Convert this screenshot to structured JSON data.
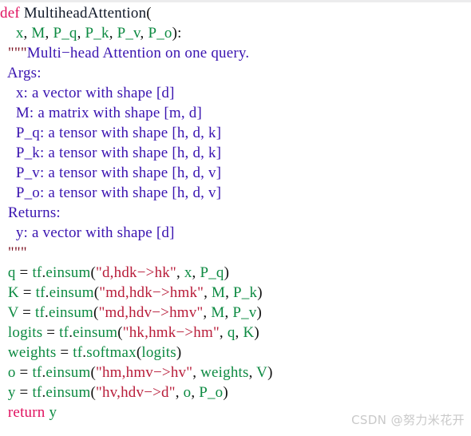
{
  "watermark": {
    "text": "CSDN @努力米花开"
  },
  "colors": {
    "background": "#ffffff",
    "keyword": "#e0115f",
    "function_name": "#101828",
    "punctuation": "#101010",
    "identifier": "#0d8a42",
    "string": "#b81d3a",
    "triple_quote": "#7a1020",
    "docstring": "#3a14b0",
    "watermark": "#c9c9c9",
    "top_strip": "#ececed"
  },
  "code": {
    "language": "python",
    "lines": [
      {
        "id": "line-01-def",
        "tokens": [
          {
            "t": "def",
            "c": "kw"
          },
          {
            "t": " ",
            "c": "punct"
          },
          {
            "t": "MultiheadAttention",
            "c": "fn"
          },
          {
            "t": "(",
            "c": "punct"
          }
        ]
      },
      {
        "id": "line-02-params",
        "tokens": [
          {
            "t": "    ",
            "c": "punct"
          },
          {
            "t": "x",
            "c": "name"
          },
          {
            "t": ", ",
            "c": "punct"
          },
          {
            "t": "M",
            "c": "name"
          },
          {
            "t": ", ",
            "c": "punct"
          },
          {
            "t": "P_q",
            "c": "name"
          },
          {
            "t": ", ",
            "c": "punct"
          },
          {
            "t": "P_k",
            "c": "name"
          },
          {
            "t": ", ",
            "c": "punct"
          },
          {
            "t": "P_v",
            "c": "name"
          },
          {
            "t": ", ",
            "c": "punct"
          },
          {
            "t": "P_o",
            "c": "name"
          },
          {
            "t": "):",
            "c": "punct"
          }
        ]
      },
      {
        "id": "line-03-docstring-open",
        "tokens": [
          {
            "t": "  ",
            "c": "punct"
          },
          {
            "t": "\"\"\"",
            "c": "quote"
          },
          {
            "t": "Multi−head Attention on one query.",
            "c": "doc"
          }
        ]
      },
      {
        "id": "line-04-args",
        "tokens": [
          {
            "t": "  ",
            "c": "punct"
          },
          {
            "t": "Args:",
            "c": "doc"
          }
        ]
      },
      {
        "id": "line-05-arg-x",
        "tokens": [
          {
            "t": "    ",
            "c": "punct"
          },
          {
            "t": "x: a vector with shape [d]",
            "c": "doc"
          }
        ]
      },
      {
        "id": "line-06-arg-M",
        "tokens": [
          {
            "t": "    ",
            "c": "punct"
          },
          {
            "t": "M: a matrix with shape [m, d]",
            "c": "doc"
          }
        ]
      },
      {
        "id": "line-07-arg-Pq",
        "tokens": [
          {
            "t": "    ",
            "c": "punct"
          },
          {
            "t": "P_q: a tensor with shape [h, d, k]",
            "c": "doc"
          }
        ]
      },
      {
        "id": "line-08-arg-Pk",
        "tokens": [
          {
            "t": "    ",
            "c": "punct"
          },
          {
            "t": "P_k: a tensor with shape [h, d, k]",
            "c": "doc"
          }
        ]
      },
      {
        "id": "line-09-arg-Pv",
        "tokens": [
          {
            "t": "    ",
            "c": "punct"
          },
          {
            "t": "P_v: a tensor with shape [h, d, v]",
            "c": "doc"
          }
        ]
      },
      {
        "id": "line-10-arg-Po",
        "tokens": [
          {
            "t": "    ",
            "c": "punct"
          },
          {
            "t": "P_o: a tensor with shape [h, d, v]",
            "c": "doc"
          }
        ]
      },
      {
        "id": "line-11-returns",
        "tokens": [
          {
            "t": "  ",
            "c": "punct"
          },
          {
            "t": "Returns:",
            "c": "doc"
          }
        ]
      },
      {
        "id": "line-12-return-y",
        "tokens": [
          {
            "t": "    ",
            "c": "punct"
          },
          {
            "t": "y: a vector with shape [d]",
            "c": "doc"
          }
        ]
      },
      {
        "id": "line-13-docstring-close",
        "tokens": [
          {
            "t": "  ",
            "c": "punct"
          },
          {
            "t": "\"\"\"",
            "c": "quote"
          }
        ]
      },
      {
        "id": "line-14-q",
        "tokens": [
          {
            "t": "  ",
            "c": "punct"
          },
          {
            "t": "q",
            "c": "name"
          },
          {
            "t": " = ",
            "c": "punct"
          },
          {
            "t": "tf",
            "c": "name"
          },
          {
            "t": ".",
            "c": "punct"
          },
          {
            "t": "einsum",
            "c": "name"
          },
          {
            "t": "(",
            "c": "punct"
          },
          {
            "t": "\"d,hdk−>hk\"",
            "c": "str"
          },
          {
            "t": ", ",
            "c": "punct"
          },
          {
            "t": "x",
            "c": "name"
          },
          {
            "t": ", ",
            "c": "punct"
          },
          {
            "t": "P_q",
            "c": "name"
          },
          {
            "t": ")",
            "c": "punct"
          }
        ]
      },
      {
        "id": "line-15-K",
        "tokens": [
          {
            "t": "  ",
            "c": "punct"
          },
          {
            "t": "K",
            "c": "name"
          },
          {
            "t": " = ",
            "c": "punct"
          },
          {
            "t": "tf",
            "c": "name"
          },
          {
            "t": ".",
            "c": "punct"
          },
          {
            "t": "einsum",
            "c": "name"
          },
          {
            "t": "(",
            "c": "punct"
          },
          {
            "t": "\"md,hdk−>hmk\"",
            "c": "str"
          },
          {
            "t": ", ",
            "c": "punct"
          },
          {
            "t": "M",
            "c": "name"
          },
          {
            "t": ", ",
            "c": "punct"
          },
          {
            "t": "P_k",
            "c": "name"
          },
          {
            "t": ")",
            "c": "punct"
          }
        ]
      },
      {
        "id": "line-16-V",
        "tokens": [
          {
            "t": "  ",
            "c": "punct"
          },
          {
            "t": "V",
            "c": "name"
          },
          {
            "t": " = ",
            "c": "punct"
          },
          {
            "t": "tf",
            "c": "name"
          },
          {
            "t": ".",
            "c": "punct"
          },
          {
            "t": "einsum",
            "c": "name"
          },
          {
            "t": "(",
            "c": "punct"
          },
          {
            "t": "\"md,hdv−>hmv\"",
            "c": "str"
          },
          {
            "t": ", ",
            "c": "punct"
          },
          {
            "t": "M",
            "c": "name"
          },
          {
            "t": ", ",
            "c": "punct"
          },
          {
            "t": "P_v",
            "c": "name"
          },
          {
            "t": ")",
            "c": "punct"
          }
        ]
      },
      {
        "id": "line-17-logits",
        "tokens": [
          {
            "t": "  ",
            "c": "punct"
          },
          {
            "t": "logits",
            "c": "name"
          },
          {
            "t": " = ",
            "c": "punct"
          },
          {
            "t": "tf",
            "c": "name"
          },
          {
            "t": ".",
            "c": "punct"
          },
          {
            "t": "einsum",
            "c": "name"
          },
          {
            "t": "(",
            "c": "punct"
          },
          {
            "t": "\"hk,hmk−>hm\"",
            "c": "str"
          },
          {
            "t": ", ",
            "c": "punct"
          },
          {
            "t": "q",
            "c": "name"
          },
          {
            "t": ", ",
            "c": "punct"
          },
          {
            "t": "K",
            "c": "name"
          },
          {
            "t": ")",
            "c": "punct"
          }
        ]
      },
      {
        "id": "line-18-weights",
        "tokens": [
          {
            "t": "  ",
            "c": "punct"
          },
          {
            "t": "weights",
            "c": "name"
          },
          {
            "t": " = ",
            "c": "punct"
          },
          {
            "t": "tf",
            "c": "name"
          },
          {
            "t": ".",
            "c": "punct"
          },
          {
            "t": "softmax",
            "c": "name"
          },
          {
            "t": "(",
            "c": "punct"
          },
          {
            "t": "logits",
            "c": "name"
          },
          {
            "t": ")",
            "c": "punct"
          }
        ]
      },
      {
        "id": "line-19-o",
        "tokens": [
          {
            "t": "  ",
            "c": "punct"
          },
          {
            "t": "o",
            "c": "name"
          },
          {
            "t": " = ",
            "c": "punct"
          },
          {
            "t": "tf",
            "c": "name"
          },
          {
            "t": ".",
            "c": "punct"
          },
          {
            "t": "einsum",
            "c": "name"
          },
          {
            "t": "(",
            "c": "punct"
          },
          {
            "t": "\"hm,hmv−>hv\"",
            "c": "str"
          },
          {
            "t": ", ",
            "c": "punct"
          },
          {
            "t": "weights",
            "c": "name"
          },
          {
            "t": ", ",
            "c": "punct"
          },
          {
            "t": "V",
            "c": "name"
          },
          {
            "t": ")",
            "c": "punct"
          }
        ]
      },
      {
        "id": "line-20-y",
        "tokens": [
          {
            "t": "  ",
            "c": "punct"
          },
          {
            "t": "y",
            "c": "name"
          },
          {
            "t": " = ",
            "c": "punct"
          },
          {
            "t": "tf",
            "c": "name"
          },
          {
            "t": ".",
            "c": "punct"
          },
          {
            "t": "einsum",
            "c": "name"
          },
          {
            "t": "(",
            "c": "punct"
          },
          {
            "t": "\"hv,hdv−>d\"",
            "c": "str"
          },
          {
            "t": ", ",
            "c": "punct"
          },
          {
            "t": "o",
            "c": "name"
          },
          {
            "t": ", ",
            "c": "punct"
          },
          {
            "t": "P_o",
            "c": "name"
          },
          {
            "t": ")",
            "c": "punct"
          }
        ]
      },
      {
        "id": "line-21-return",
        "tokens": [
          {
            "t": "  ",
            "c": "punct"
          },
          {
            "t": "return",
            "c": "kw"
          },
          {
            "t": " ",
            "c": "punct"
          },
          {
            "t": "y",
            "c": "name"
          }
        ]
      }
    ]
  }
}
